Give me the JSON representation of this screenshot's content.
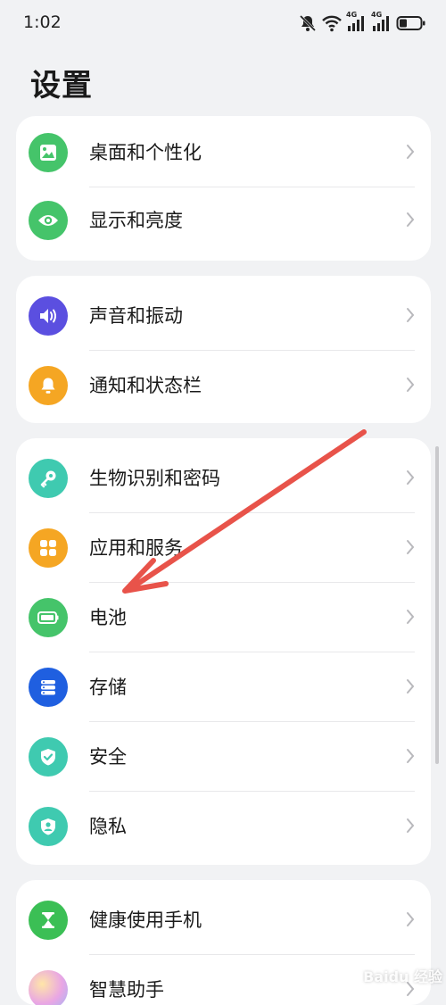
{
  "status_bar": {
    "time": "1:02",
    "icons": [
      "mute-bell-icon",
      "wifi-icon",
      "signal-4g-icon",
      "signal-4g-icon",
      "battery-icon"
    ],
    "network_label": "4G"
  },
  "page_title": "设置",
  "groups": [
    {
      "items": [
        {
          "label": "桌面和个性化",
          "icon": "wallpaper-icon",
          "color": "#45c46a"
        },
        {
          "label": "显示和亮度",
          "icon": "eye-icon",
          "color": "#45c46a"
        }
      ]
    },
    {
      "items": [
        {
          "label": "声音和振动",
          "icon": "speaker-icon",
          "color": "#5b4fe0"
        },
        {
          "label": "通知和状态栏",
          "icon": "bell-icon",
          "color": "#f5a623"
        }
      ]
    },
    {
      "items": [
        {
          "label": "生物识别和密码",
          "icon": "key-icon",
          "color": "#3fcab0"
        },
        {
          "label": "应用和服务",
          "icon": "apps-grid-icon",
          "color": "#f5a623"
        },
        {
          "label": "电池",
          "icon": "battery-icon",
          "color": "#45c46a"
        },
        {
          "label": "存储",
          "icon": "storage-icon",
          "color": "#1f5fe0"
        },
        {
          "label": "安全",
          "icon": "shield-check-icon",
          "color": "#3fcab0"
        },
        {
          "label": "隐私",
          "icon": "privacy-shield-icon",
          "color": "#3fcab0"
        }
      ]
    },
    {
      "items": [
        {
          "label": "健康使用手机",
          "icon": "hourglass-icon",
          "color": "#3bbf55"
        },
        {
          "label": "智慧助手",
          "icon": "assistant-icon",
          "color": "#c9a3f0"
        }
      ]
    }
  ],
  "annotation": {
    "type": "red-arrow",
    "points_to": "电池",
    "color": "#e8534a"
  },
  "watermark": {
    "text": "Baidu 经验"
  }
}
